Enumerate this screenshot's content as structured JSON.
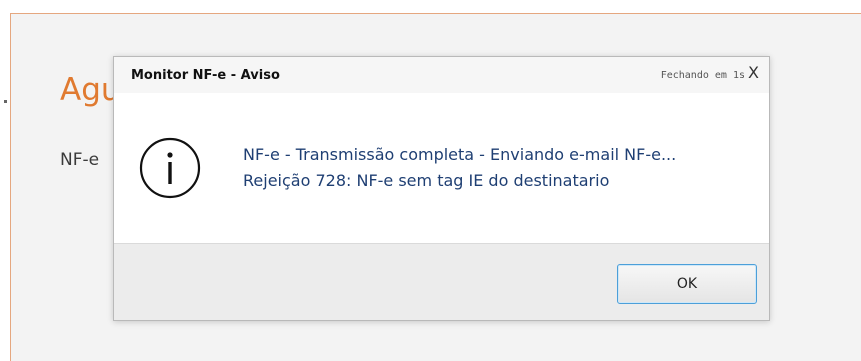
{
  "background_window": {
    "title_partial": "Agu",
    "text_partial": "NF-e"
  },
  "dialog": {
    "title": "Monitor NF-e - Aviso",
    "auto_close_text": "Fechando em 1s",
    "close_label": "X",
    "icon": "info-icon",
    "message_line1": "NF-e - Transmissão completa - Enviando e-mail NF-e...",
    "message_line2": "Rejeição 728: NF-e sem tag IE do destinatario",
    "ok_label": "OK"
  },
  "colors": {
    "background_title": "#e07a30",
    "message_text": "#1f3f73",
    "ok_border": "#4c9fd9"
  }
}
